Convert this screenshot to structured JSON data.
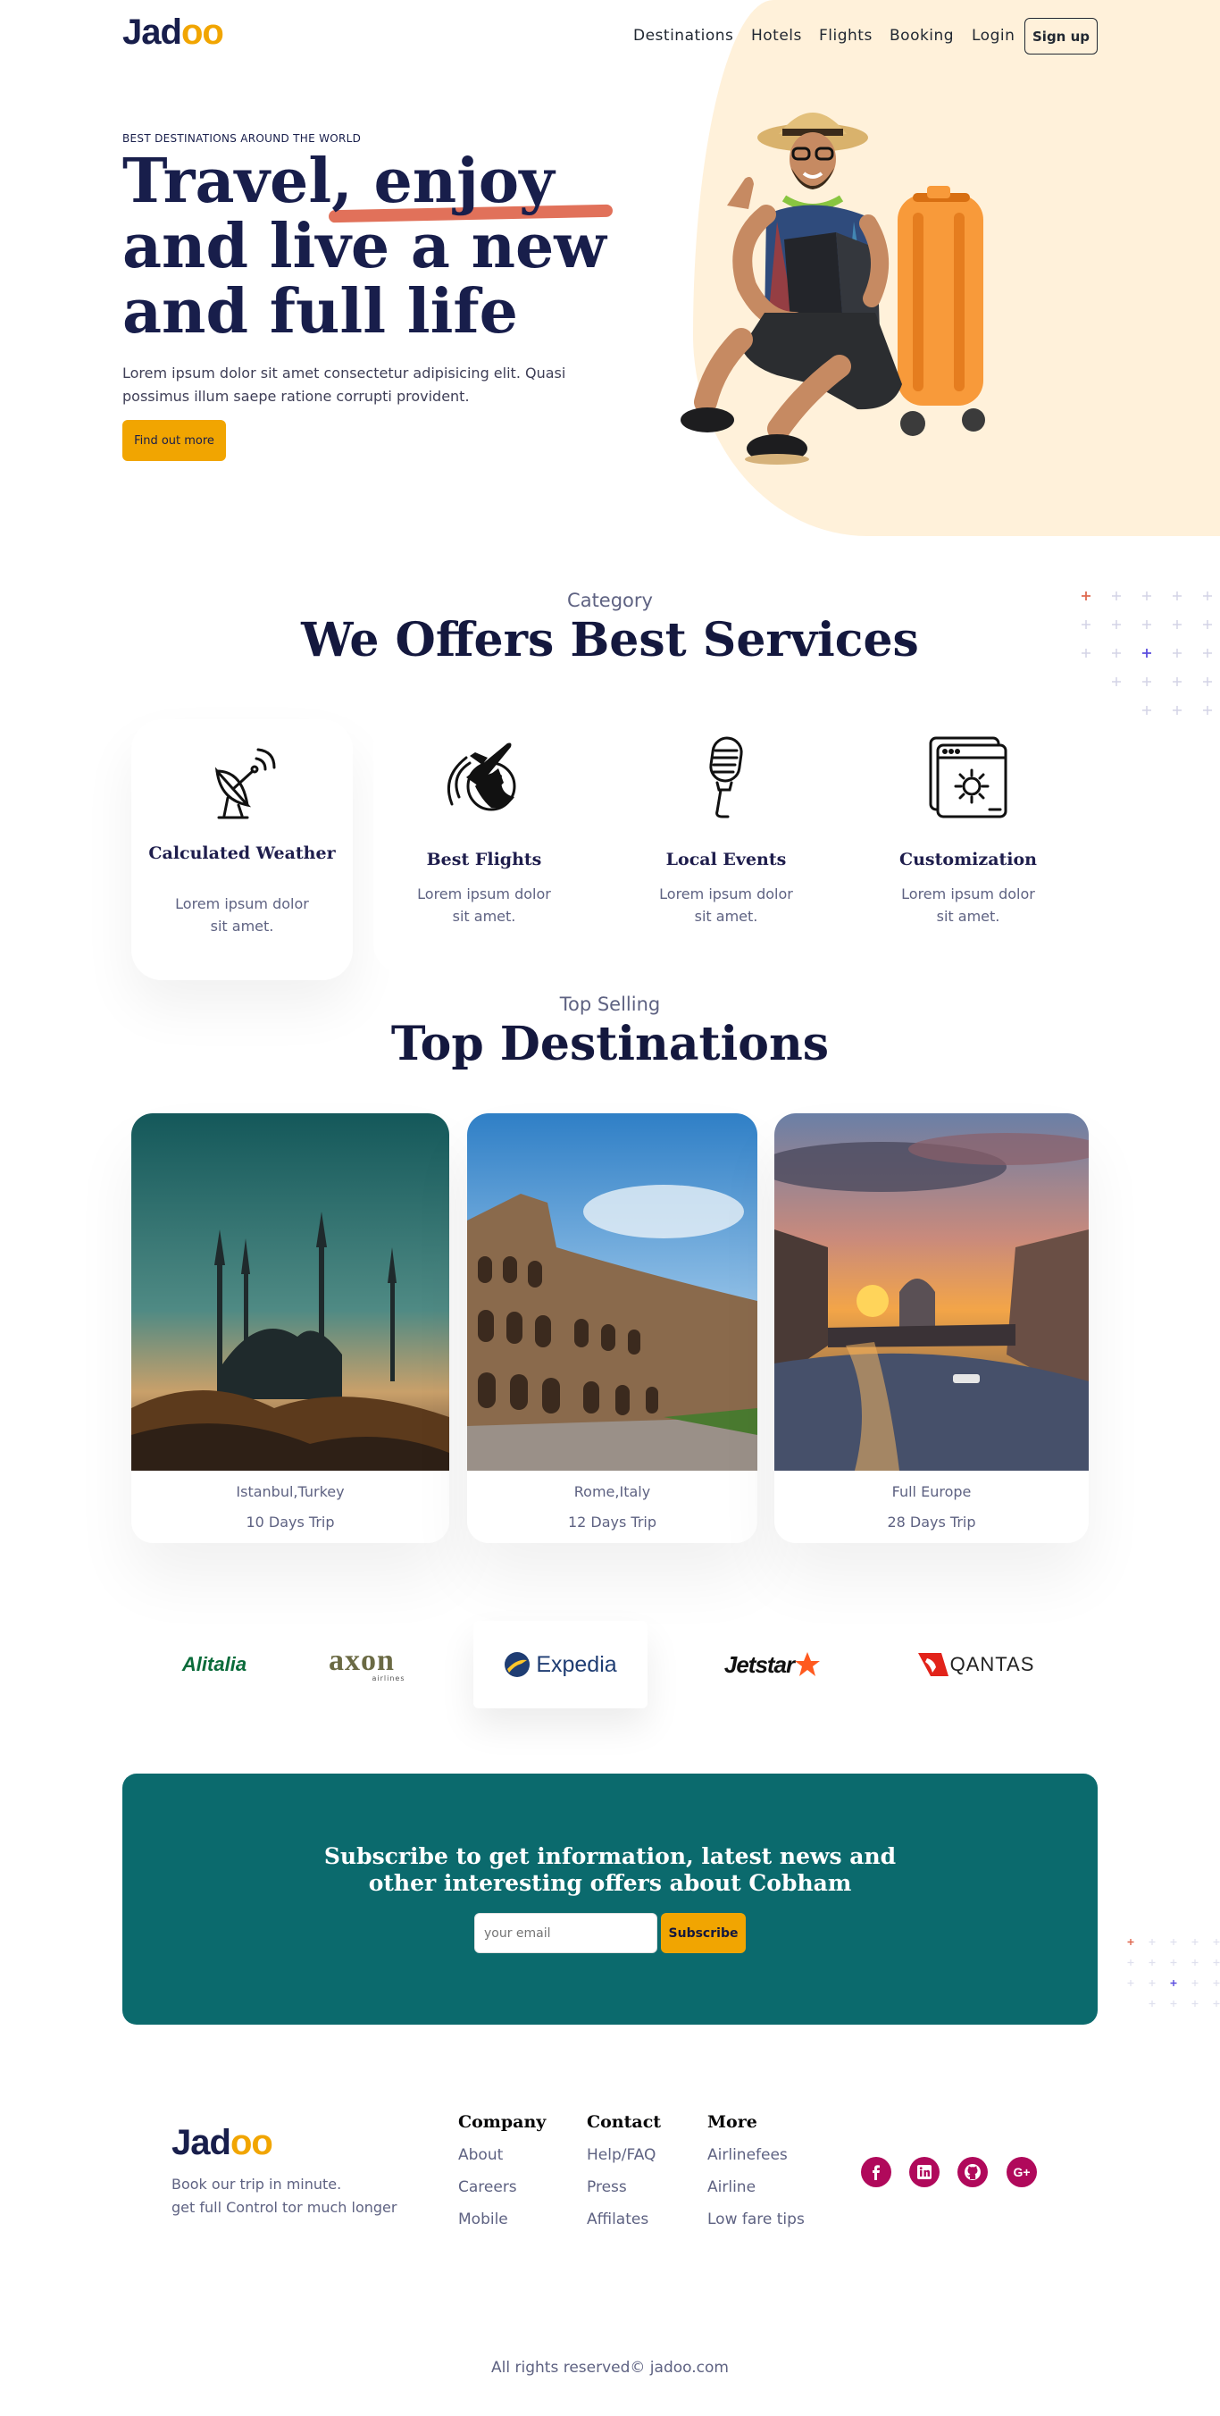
{
  "header": {
    "logo": {
      "main": "Jad",
      "accent": "oo"
    },
    "nav": [
      "Destinations",
      "Hotels",
      "Flights",
      "Booking",
      "Login"
    ],
    "signup_label": "Sign up"
  },
  "hero": {
    "eyebrow": "BEST DESTINATIONS AROUND THE WORLD",
    "title_line1": "Travel, enjoy",
    "title_line2": "and live a new",
    "title_line3": "and full life",
    "text": "Lorem ipsum dolor sit amet consectetur adipisicing elit. Quasi possimus illum saepe ratione corrupti provident.",
    "button_label": "Find out more"
  },
  "services": {
    "label": "Category",
    "title": "We Offers Best Services",
    "items": [
      {
        "title": "Calculated Weather",
        "text": "Lorem ipsum dolor sit amet.",
        "icon": "satellite-dish-icon"
      },
      {
        "title": "Best Flights",
        "text": "Lorem ipsum dolor sit amet.",
        "icon": "plane-globe-icon"
      },
      {
        "title": "Local Events",
        "text": "Lorem ipsum dolor sit amet.",
        "icon": "microphone-icon"
      },
      {
        "title": "Customization",
        "text": "Lorem ipsum dolor sit amet.",
        "icon": "settings-window-icon"
      }
    ]
  },
  "destinations": {
    "label": "Top Selling",
    "title": "Top Destinations",
    "items": [
      {
        "name": "Istanbul,Turkey",
        "days": "10 Days Trip"
      },
      {
        "name": "Rome,Italy",
        "days": "12 Days Trip"
      },
      {
        "name": "Full Europe",
        "days": "28 Days Trip"
      }
    ]
  },
  "partners": {
    "alitalia": "Alitalia",
    "axon_main": "axon",
    "axon_sub": "airlines",
    "expedia": "Expedia",
    "jetstar": "Jetstar",
    "qantas": "QANTAS"
  },
  "subscribe": {
    "title_line1": "Subscribe to get information, latest news and",
    "title_line2": "other interesting offers about Cobham",
    "placeholder": "your email",
    "button_label": "Subscribe"
  },
  "footer": {
    "logo": {
      "main": "Jad",
      "accent": "oo"
    },
    "tagline_line1": "Book our trip in minute.",
    "tagline_line2": "get full Control tor much longer",
    "columns": [
      {
        "heading": "Company",
        "links": [
          "About",
          "Careers",
          "Mobile"
        ]
      },
      {
        "heading": "Contact",
        "links": [
          "Help/FAQ",
          "Press",
          "Affilates"
        ]
      },
      {
        "heading": "More",
        "links": [
          "Airlinefees",
          "Airline",
          "Low fare tips"
        ]
      }
    ],
    "social": [
      "facebook-icon",
      "linkedin-icon",
      "github-icon",
      "google-plus-icon"
    ],
    "copyright": "All rights reserved© jadoo.com"
  },
  "colors": {
    "brand_navy": "#181e4b",
    "accent_orange": "#f1a501",
    "accent_coral": "#df6951",
    "subscribe_teal": "#0b6a6d",
    "social_magenta": "#b0095b",
    "hero_blob": "#fff1da"
  }
}
